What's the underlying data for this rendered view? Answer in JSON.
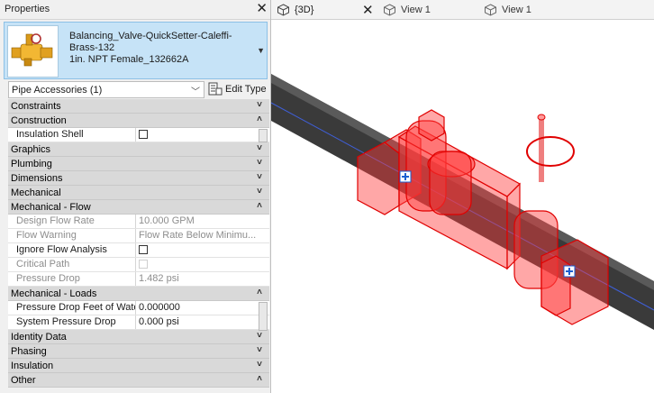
{
  "properties": {
    "title": "Properties",
    "close": "✕",
    "type_selector": {
      "line1": "Balancing_Valve-QuickSetter-Caleffi-",
      "line2": "Brass-132",
      "line3": "1in. NPT Female_132662A"
    },
    "filter": {
      "label": "Pipe Accessories (1)"
    },
    "edit_type_label": "Edit Type",
    "rows": [
      {
        "kind": "cat",
        "label": "Constraints",
        "state": "collapsed"
      },
      {
        "kind": "cat",
        "label": "Construction",
        "state": "expanded"
      },
      {
        "kind": "prop",
        "label": "Insulation Shell",
        "value": "",
        "checkbox": true,
        "readonly": false
      },
      {
        "kind": "cat",
        "label": "Graphics",
        "state": "collapsed"
      },
      {
        "kind": "cat",
        "label": "Plumbing",
        "state": "collapsed"
      },
      {
        "kind": "cat",
        "label": "Dimensions",
        "state": "collapsed"
      },
      {
        "kind": "cat",
        "label": "Mechanical",
        "state": "collapsed"
      },
      {
        "kind": "cat",
        "label": "Mechanical - Flow",
        "state": "expanded"
      },
      {
        "kind": "prop",
        "label": "Design Flow Rate",
        "value": "10.000 GPM",
        "readonly": true
      },
      {
        "kind": "prop",
        "label": "Flow Warning",
        "value": "Flow Rate Below Minimu...",
        "readonly": true
      },
      {
        "kind": "prop",
        "label": "Ignore Flow Analysis",
        "value": "",
        "checkbox": true,
        "readonly": false
      },
      {
        "kind": "prop",
        "label": "Critical Path",
        "value": "",
        "checkbox": true,
        "readonly": true
      },
      {
        "kind": "prop",
        "label": "Pressure Drop",
        "value": "1.482 psi",
        "readonly": true
      },
      {
        "kind": "cat",
        "label": "Mechanical - Loads",
        "state": "expanded"
      },
      {
        "kind": "prop",
        "label": "Pressure Drop Feet of Water",
        "value": "0.000000",
        "readonly": false
      },
      {
        "kind": "prop",
        "label": "System Pressure Drop",
        "value": "0.000 psi",
        "readonly": false
      },
      {
        "kind": "cat",
        "label": "Identity Data",
        "state": "collapsed"
      },
      {
        "kind": "cat",
        "label": "Phasing",
        "state": "collapsed"
      },
      {
        "kind": "cat",
        "label": "Insulation",
        "state": "collapsed"
      },
      {
        "kind": "cat",
        "label": "Other",
        "state": "expanded"
      }
    ]
  },
  "tabs": [
    {
      "label": "{3D}",
      "icon": "3d-view-icon",
      "active": true,
      "close": "✕"
    },
    {
      "label": "View 1",
      "icon": "3d-view-icon",
      "active": false
    },
    {
      "label": "View 1",
      "icon": "3d-view-icon",
      "active": false
    }
  ],
  "colors": {
    "selection": "#ff3b3b",
    "pipe": "#3a3a3a",
    "type_selector_bg": "#c6e3f7"
  }
}
